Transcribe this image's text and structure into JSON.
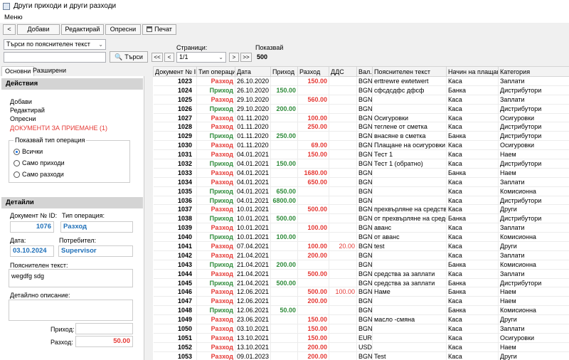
{
  "window": {
    "title": "Други приходи и други разходи"
  },
  "menu": {
    "label": "Меню"
  },
  "toolbar": {
    "back_label": "<",
    "add_label": "Добави",
    "edit_label": "Редактирай",
    "refresh_label": "Опресни",
    "print_label": "Печат"
  },
  "search": {
    "mode_selected": "Търси по пояснителен текст",
    "input_value": "",
    "button_label": "Търси"
  },
  "pager": {
    "label": "Страници:",
    "first": "<<",
    "prev": "<",
    "current": "1/1",
    "next": ">",
    "last": ">>",
    "show_label": "Показвай",
    "show_value": "500"
  },
  "tabs": {
    "main": "Основни",
    "extended": "Разширени"
  },
  "actions": {
    "header": "Действия",
    "add": "Добави",
    "edit": "Редактирай",
    "refresh": "Опресни",
    "documents_pending": "ДОКУМЕНТИ ЗА ПРИЕМАНЕ (1)",
    "filter_title": "Показвай тип операция",
    "filter_options": [
      "Всички",
      "Само приходи",
      "Само разходи"
    ],
    "filter_selected": "Всички"
  },
  "details": {
    "header": "Детайли",
    "doc_id_label": "Документ № ID:",
    "doc_id_value": "1076",
    "op_type_label": "Тип операция:",
    "op_type_value": "Разход",
    "date_label": "Дата:",
    "date_value": "03.10.2024",
    "user_label": "Потребител:",
    "user_value": "Supervisor",
    "note_label": "Пояснителен текст:",
    "note_value": "wegdfg sdg",
    "desc_label": "Детайлно описание:",
    "desc_value": "",
    "income_label": "Приход:",
    "income_value": "",
    "expense_label": "Разход:",
    "expense_value": "50.00"
  },
  "colors": {
    "income": "#2e8b3a",
    "expense": "#e53935",
    "accent": "#1e6fb8"
  },
  "grid": {
    "columns": [
      "Документ № ID",
      "Тип операция",
      "Дата",
      "Приход",
      "Разход",
      "ДДС",
      "Вал.",
      "Пояснителен текст",
      "Начин на плащане",
      "Категория"
    ],
    "rows": [
      [
        "1023",
        "Разход",
        "26.10.2020",
        "",
        "150.00",
        "",
        "BGN",
        "erttrewre ewtetwert",
        "Каса",
        "Заплати"
      ],
      [
        "1024",
        "Приход",
        "26.10.2020",
        "150.00",
        "",
        "",
        "BGN",
        "сфсдсдфс дфсф",
        "Банка",
        "Дистрибутори"
      ],
      [
        "1025",
        "Разход",
        "29.10.2020",
        "",
        "560.00",
        "",
        "BGN",
        "",
        "Каса",
        "Заплати"
      ],
      [
        "1026",
        "Приход",
        "29.10.2020",
        "200.00",
        "",
        "",
        "BGN",
        "",
        "Каса",
        "Дистрибутори"
      ],
      [
        "1027",
        "Разход",
        "01.11.2020",
        "",
        "100.00",
        "",
        "BGN",
        "Осигуровки",
        "Каса",
        "Осигуровки"
      ],
      [
        "1028",
        "Разход",
        "01.11.2020",
        "",
        "250.00",
        "",
        "BGN",
        "теглене от сметка",
        "Каса",
        "Дистрибутори"
      ],
      [
        "1029",
        "Приход",
        "01.11.2020",
        "250.00",
        "",
        "",
        "BGN",
        "внасяне в сметка",
        "Банка",
        "Дистрибутори"
      ],
      [
        "1030",
        "Разход",
        "01.11.2020",
        "",
        "69.00",
        "",
        "BGN",
        "Плащане на осигуровки",
        "Каса",
        "Осигуровки"
      ],
      [
        "1031",
        "Разход",
        "04.01.2021",
        "",
        "150.00",
        "",
        "BGN",
        "Тест 1",
        "Каса",
        "Наем"
      ],
      [
        "1032",
        "Приход",
        "04.01.2021",
        "150.00",
        "",
        "",
        "BGN",
        "Тест 1 (обратно)",
        "Каса",
        "Дистрибутори"
      ],
      [
        "1033",
        "Разход",
        "04.01.2021",
        "",
        "1680.00",
        "",
        "BGN",
        "",
        "Банка",
        "Наем"
      ],
      [
        "1034",
        "Разход",
        "04.01.2021",
        "",
        "650.00",
        "",
        "BGN",
        "",
        "Каса",
        "Заплати"
      ],
      [
        "1035",
        "Приход",
        "04.01.2021",
        "650.00",
        "",
        "",
        "BGN",
        "",
        "Каса",
        "Комисионна"
      ],
      [
        "1036",
        "Приход",
        "04.01.2021",
        "6800.00",
        "",
        "",
        "BGN",
        "",
        "Каса",
        "Дистрибутори"
      ],
      [
        "1037",
        "Разход",
        "10.01.2021",
        "",
        "500.00",
        "",
        "BGN",
        "прехвърляне на средства",
        "Каса",
        "Други"
      ],
      [
        "1038",
        "Приход",
        "10.01.2021",
        "500.00",
        "",
        "",
        "BGN",
        "от прехвърляне на средства",
        "Банка",
        "Дистрибутори"
      ],
      [
        "1039",
        "Разход",
        "10.01.2021",
        "",
        "100.00",
        "",
        "BGN",
        "аванс",
        "Каса",
        "Заплати"
      ],
      [
        "1040",
        "Приход",
        "10.01.2021",
        "100.00",
        "",
        "",
        "BGN",
        "от аванс",
        "Каса",
        "Комисионна"
      ],
      [
        "1041",
        "Разход",
        "07.04.2021",
        "",
        "100.00",
        "20.00",
        "BGN",
        "test",
        "Каса",
        "Други"
      ],
      [
        "1042",
        "Разход",
        "21.04.2021",
        "",
        "200.00",
        "",
        "BGN",
        "",
        "Каса",
        "Заплати"
      ],
      [
        "1043",
        "Приход",
        "21.04.2021",
        "200.00",
        "",
        "",
        "BGN",
        "",
        "Банка",
        "Комисионна"
      ],
      [
        "1044",
        "Разход",
        "21.04.2021",
        "",
        "500.00",
        "",
        "BGN",
        "средства за заплати",
        "Каса",
        "Заплати"
      ],
      [
        "1045",
        "Приход",
        "21.04.2021",
        "500.00",
        "",
        "",
        "BGN",
        "средства за заплати",
        "Банка",
        "Дистрибутори"
      ],
      [
        "1046",
        "Разход",
        "12.06.2021",
        "",
        "500.00",
        "100.00",
        "BGN",
        "Наме",
        "Банка",
        "Наем"
      ],
      [
        "1047",
        "Разход",
        "12.06.2021",
        "",
        "200.00",
        "",
        "BGN",
        "",
        "Каса",
        "Наем"
      ],
      [
        "1048",
        "Приход",
        "12.06.2021",
        "50.00",
        "",
        "",
        "BGN",
        "",
        "Банка",
        "Комисионна"
      ],
      [
        "1049",
        "Разход",
        "23.06.2021",
        "",
        "150.00",
        "",
        "BGN",
        "масло -смяна",
        "Каса",
        "Други"
      ],
      [
        "1050",
        "Разход",
        "03.10.2021",
        "",
        "150.00",
        "",
        "BGN",
        "",
        "Каса",
        "Заплати"
      ],
      [
        "1051",
        "Разход",
        "13.10.2021",
        "",
        "150.00",
        "",
        "EUR",
        "",
        "Каса",
        "Осигуровки"
      ],
      [
        "1052",
        "Разход",
        "13.10.2021",
        "",
        "200.00",
        "",
        "USD",
        "",
        "Каса",
        "Наем"
      ],
      [
        "1053",
        "Разход",
        "09.01.2023",
        "",
        "200.00",
        "",
        "BGN",
        "Test",
        "Каса",
        "Други"
      ]
    ]
  }
}
